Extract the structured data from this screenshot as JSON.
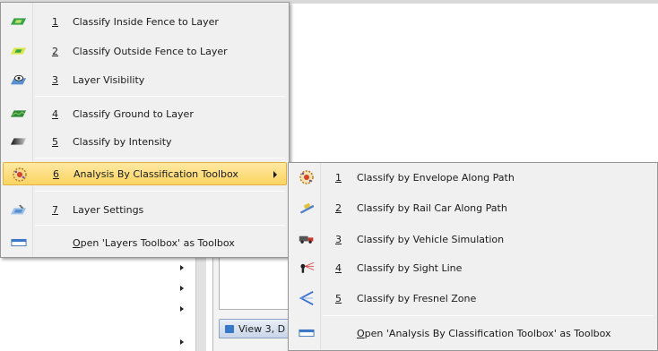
{
  "background": {
    "tab_label": "View 3, D"
  },
  "main_menu": {
    "items": [
      {
        "num": "1",
        "label": "Classify Inside Fence to Layer",
        "icon": "layer-plane-icon"
      },
      {
        "num": "2",
        "label": "Classify Outside Fence to Layer",
        "icon": "layer-plane-icon"
      },
      {
        "num": "3",
        "label": "Layer Visibility",
        "icon": "layer-eye-icon"
      },
      {
        "num": "4",
        "label": "Classify Ground to Layer",
        "icon": "layer-ground-icon"
      },
      {
        "num": "5",
        "label": "Classify by Intensity",
        "icon": "layer-intensity-icon"
      },
      {
        "num": "6",
        "label": "Analysis By Classification Toolbox",
        "icon": "analysis-toolbox-icon"
      },
      {
        "num": "7",
        "label": "Layer Settings",
        "icon": "layer-settings-icon"
      },
      {
        "num": "",
        "label": "Open 'Layers Toolbox' as Toolbox",
        "icon": "toolbox-icon"
      }
    ]
  },
  "sub_menu": {
    "items": [
      {
        "num": "1",
        "label": "Classify by Envelope Along Path",
        "icon": "envelope-path-icon"
      },
      {
        "num": "2",
        "label": "Classify by Rail Car Along Path",
        "icon": "rail-car-icon"
      },
      {
        "num": "3",
        "label": "Classify by Vehicle Simulation",
        "icon": "vehicle-icon"
      },
      {
        "num": "4",
        "label": "Classify by Sight Line",
        "icon": "sight-line-icon"
      },
      {
        "num": "5",
        "label": "Classify by Fresnel Zone",
        "icon": "fresnel-zone-icon"
      },
      {
        "num": "",
        "label": "Open 'Analysis By Classification Toolbox' as Toolbox",
        "icon": "toolbox-icon"
      }
    ]
  }
}
